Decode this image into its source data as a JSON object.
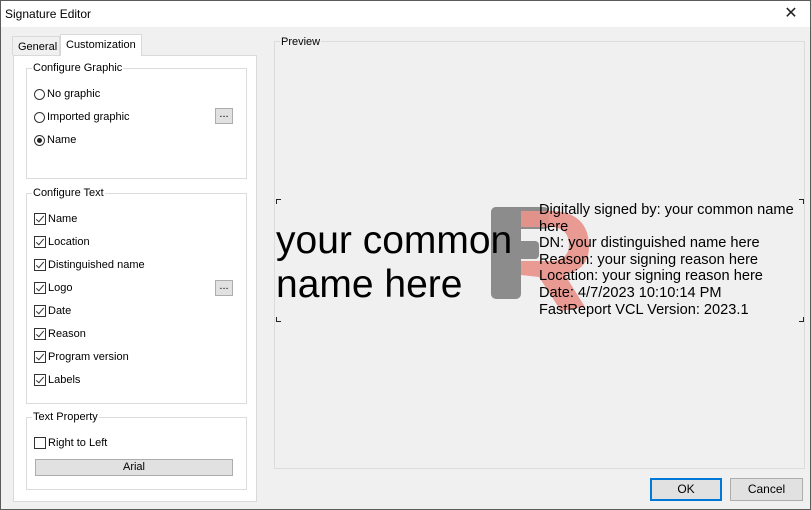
{
  "window": {
    "title": "Signature Editor",
    "close_icon": "close-icon"
  },
  "tabs": [
    {
      "label": "General",
      "active": false
    },
    {
      "label": "Customization",
      "active": true
    }
  ],
  "configure_graphic": {
    "label": "Configure Graphic",
    "options": [
      {
        "label": "No graphic",
        "selected": false
      },
      {
        "label": "Imported graphic",
        "selected": false
      },
      {
        "label": "Name",
        "selected": true
      }
    ],
    "browse_label": "..."
  },
  "configure_text": {
    "label": "Configure Text",
    "items": [
      {
        "label": "Name",
        "checked": true
      },
      {
        "label": "Location",
        "checked": true
      },
      {
        "label": "Distinguished name",
        "checked": true
      },
      {
        "label": "Logo",
        "checked": true
      },
      {
        "label": "Date",
        "checked": true
      },
      {
        "label": "Reason",
        "checked": true
      },
      {
        "label": "Program version",
        "checked": true
      },
      {
        "label": "Labels",
        "checked": true
      }
    ],
    "logo_browse_label": "..."
  },
  "text_property": {
    "label": "Text Property",
    "rtl_label": "Right to Left",
    "rtl_checked": false,
    "font_button_label": "Arial"
  },
  "preview": {
    "label": "Preview",
    "name_line1": "your common",
    "name_line2": "name here",
    "logo_colors": {
      "gray": "#8c8c8c",
      "red": "#e8938a"
    },
    "lines": [
      "Digitally signed by: your common name",
      "here",
      "DN: your distinguished name here",
      "Reason: your signing reason here",
      "Location: your signing reason here",
      "Date: 4/7/2023 10:10:14 PM",
      "FastReport VCL Version: 2023.1"
    ]
  },
  "buttons": {
    "ok": "OK",
    "cancel": "Cancel"
  },
  "colors": {
    "accent": "#0078d7"
  }
}
